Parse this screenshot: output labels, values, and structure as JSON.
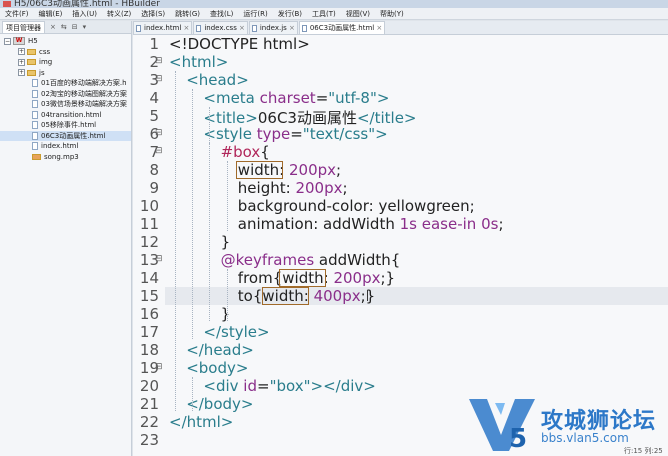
{
  "window": {
    "title": "H5/06C3动画属性.html - HBuilder"
  },
  "menu": [
    "文件(F)",
    "编辑(E)",
    "插入(U)",
    "转义(Z)",
    "选择(S)",
    "跳转(G)",
    "查找(L)",
    "运行(R)",
    "发行(B)",
    "工具(T)",
    "视图(V)",
    "帮助(Y)"
  ],
  "project_panel": {
    "tab_label": "项目管理器",
    "tree": [
      {
        "label": "H5",
        "kind": "project",
        "depth": 0,
        "expanded": true
      },
      {
        "label": "css",
        "kind": "folder",
        "depth": 1
      },
      {
        "label": "img",
        "kind": "folder",
        "depth": 1
      },
      {
        "label": "js",
        "kind": "folder",
        "depth": 1
      },
      {
        "label": "01百度的移动端解决方案.h",
        "kind": "file",
        "depth": 2
      },
      {
        "label": "02淘宝的移动端图解决方案",
        "kind": "file",
        "depth": 2
      },
      {
        "label": "03微信场景移动端解决方案",
        "kind": "file",
        "depth": 2
      },
      {
        "label": "04transition.html",
        "kind": "file",
        "depth": 2
      },
      {
        "label": "05移除事件.html",
        "kind": "file",
        "depth": 2
      },
      {
        "label": "06C3动画属性.html",
        "kind": "file",
        "depth": 2
      },
      {
        "label": "index.html",
        "kind": "file",
        "depth": 2
      },
      {
        "label": "song.mp3",
        "kind": "media",
        "depth": 2
      }
    ]
  },
  "editor_tabs": [
    {
      "label": "index.html",
      "active": false
    },
    {
      "label": "index.css",
      "active": false
    },
    {
      "label": "index.js",
      "active": false
    },
    {
      "label": "06C3动画属性.html",
      "active": true
    }
  ],
  "editor": {
    "current_line": 15,
    "lines": [
      {
        "n": "1",
        "fold": "",
        "indent": 0,
        "tokens": [
          [
            "t-doc",
            "<!DOCTYPE html>"
          ]
        ]
      },
      {
        "n": "2",
        "fold": "⊟",
        "indent": 0,
        "tokens": [
          [
            "t-tag",
            "<html>"
          ]
        ]
      },
      {
        "n": "3",
        "fold": "⊟",
        "indent": 1,
        "tokens": [
          [
            "t-tag",
            "<head>"
          ]
        ]
      },
      {
        "n": "4",
        "fold": "",
        "indent": 2,
        "tokens": [
          [
            "t-tag",
            "<meta "
          ],
          [
            "t-attr",
            "charset"
          ],
          [
            "t-pun",
            "="
          ],
          [
            "t-str",
            "\"utf-8\""
          ],
          [
            "t-tag",
            ">"
          ]
        ]
      },
      {
        "n": "5",
        "fold": "",
        "indent": 2,
        "tokens": [
          [
            "t-tag",
            "<title>"
          ],
          [
            "t-val",
            "06C3动画属性"
          ],
          [
            "t-tag",
            "</title>"
          ]
        ]
      },
      {
        "n": "6",
        "fold": "⊟",
        "indent": 2,
        "tokens": [
          [
            "t-tag",
            "<style "
          ],
          [
            "t-attr",
            "type"
          ],
          [
            "t-pun",
            "="
          ],
          [
            "t-str",
            "\"text/css\""
          ],
          [
            "t-tag",
            ">"
          ]
        ]
      },
      {
        "n": "7",
        "fold": "⊟",
        "indent": 3,
        "tokens": [
          [
            "t-sel",
            "#box"
          ],
          [
            "t-pun",
            "{"
          ]
        ]
      },
      {
        "n": "8",
        "fold": "",
        "indent": 4,
        "tokens": [
          [
            "t-prop",
            "width"
          ],
          [
            "t-pun",
            ": "
          ],
          [
            "t-num",
            "200px"
          ],
          [
            "t-pun",
            ";"
          ]
        ]
      },
      {
        "n": "9",
        "fold": "",
        "indent": 4,
        "tokens": [
          [
            "t-prop",
            "height"
          ],
          [
            "t-pun",
            ": "
          ],
          [
            "t-num",
            "200px"
          ],
          [
            "t-pun",
            ";"
          ]
        ]
      },
      {
        "n": "10",
        "fold": "",
        "indent": 4,
        "tokens": [
          [
            "t-prop",
            "background-color"
          ],
          [
            "t-pun",
            ": "
          ],
          [
            "t-val",
            "yellowgreen"
          ],
          [
            "t-pun",
            ";"
          ]
        ]
      },
      {
        "n": "11",
        "fold": "",
        "indent": 4,
        "tokens": [
          [
            "t-prop",
            "animation"
          ],
          [
            "t-pun",
            ": "
          ],
          [
            "t-val",
            "addWidth "
          ],
          [
            "t-num",
            "1s "
          ],
          [
            "t-kw",
            "ease-in "
          ],
          [
            "t-num",
            "0s"
          ],
          [
            "t-pun",
            ";"
          ]
        ]
      },
      {
        "n": "12",
        "fold": "",
        "indent": 3,
        "tokens": [
          [
            "t-pun",
            "}"
          ]
        ]
      },
      {
        "n": "13",
        "fold": "⊟",
        "indent": 3,
        "tokens": [
          [
            "t-kw",
            "@keyframes "
          ],
          [
            "t-val",
            "addWidth"
          ],
          [
            "t-pun",
            "{"
          ]
        ]
      },
      {
        "n": "14",
        "fold": "",
        "indent": 4,
        "tokens": [
          [
            "t-val",
            "from"
          ],
          [
            "t-pun",
            "{"
          ],
          [
            "t-prop",
            "width"
          ],
          [
            "t-pun",
            ": "
          ],
          [
            "t-num",
            "200px"
          ],
          [
            "t-pun",
            ";}"
          ]
        ]
      },
      {
        "n": "15",
        "fold": "",
        "indent": 4,
        "tokens": [
          [
            "t-val",
            "to"
          ],
          [
            "t-pun",
            "{"
          ],
          [
            "t-prop",
            "width"
          ],
          [
            "t-pun",
            ": "
          ],
          [
            "t-num",
            "400px"
          ],
          [
            "t-pun",
            ";}"
          ]
        ]
      },
      {
        "n": "16",
        "fold": "",
        "indent": 3,
        "tokens": [
          [
            "t-pun",
            "}"
          ]
        ]
      },
      {
        "n": "17",
        "fold": "",
        "indent": 2,
        "tokens": [
          [
            "t-tag",
            "</style>"
          ]
        ]
      },
      {
        "n": "18",
        "fold": "",
        "indent": 1,
        "tokens": [
          [
            "t-tag",
            "</head>"
          ]
        ]
      },
      {
        "n": "19",
        "fold": "⊟",
        "indent": 1,
        "tokens": [
          [
            "t-tag",
            "<body>"
          ]
        ]
      },
      {
        "n": "20",
        "fold": "",
        "indent": 2,
        "tokens": [
          [
            "t-tag",
            "<div "
          ],
          [
            "t-attr",
            "id"
          ],
          [
            "t-pun",
            "="
          ],
          [
            "t-str",
            "\"box\""
          ],
          [
            "t-tag",
            "></div>"
          ]
        ]
      },
      {
        "n": "21",
        "fold": "",
        "indent": 1,
        "tokens": [
          [
            "t-tag",
            "</body>"
          ]
        ]
      },
      {
        "n": "22",
        "fold": "",
        "indent": 0,
        "tokens": [
          [
            "t-tag",
            "</html>"
          ]
        ]
      },
      {
        "n": "23",
        "fold": "",
        "indent": 0,
        "tokens": []
      }
    ]
  },
  "watermark": {
    "brand": "攻城狮论坛",
    "url": "bbs.vlan5.com"
  },
  "status": {
    "position": "行:15 列:25"
  },
  "colors": {
    "accent": "#2d78c8",
    "tag": "#2a7d8c",
    "attr": "#8a2e8a",
    "selector": "#b0265a"
  }
}
